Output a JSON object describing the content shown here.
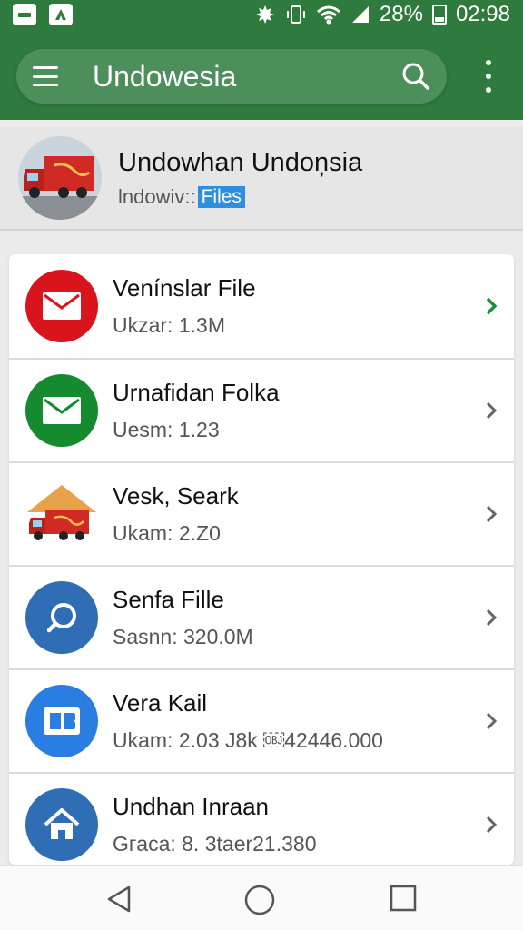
{
  "status_bar": {
    "battery": "28%",
    "time": "02:98",
    "icons": [
      "app-notification-icon",
      "drive-icon",
      "settings-gear-icon",
      "vibrate-icon",
      "wifi-icon",
      "signal-icon",
      "battery-icon"
    ]
  },
  "app_bar": {
    "title": "Undowesia",
    "icons": [
      "menu-icon",
      "search-icon",
      "more-vertical-icon"
    ]
  },
  "header": {
    "title": "Undowhan Undon̦sia",
    "subtitle_prefix": "lndowiv::",
    "subtitle_tag": "Files"
  },
  "list": [
    {
      "title": "Venínslar File",
      "subtitle": "Ukzar: 1.3M",
      "icon": "mail-icon",
      "icon_color": "#d9141d",
      "chevron_color": "#1e8f3a"
    },
    {
      "title": "Urnafidan Folkа",
      "subtitle": "Uesm: 1.23",
      "icon": "mail-icon",
      "icon_color": "#168a2e",
      "chevron_color": "#666666"
    },
    {
      "title": "Vesk, Seark",
      "subtitle": "Ukam: 2.Z0",
      "icon": "delivery-truck-icon",
      "icon_color": "#e8a24a",
      "chevron_color": "#666666"
    },
    {
      "title": "Senfa Fille",
      "subtitle": "Sasnn: 320.0M",
      "icon": "search-icon",
      "icon_color": "#2f6db5",
      "chevron_color": "#666666"
    },
    {
      "title": "Vera Kail",
      "subtitle": "Ukam: 2.03 Ј8k ￼42446.000",
      "icon": "book-icon",
      "icon_color": "#2a7de1",
      "chevron_color": "#666666"
    },
    {
      "title": "Undhan Inraan",
      "subtitle": "Gгaca: 8. 3taer21.380",
      "icon": "home-icon",
      "icon_color": "#2f6db5",
      "chevron_color": "#666666"
    }
  ],
  "nav_bar": {
    "icons": [
      "back-icon",
      "home-circle-icon",
      "recents-icon"
    ]
  }
}
